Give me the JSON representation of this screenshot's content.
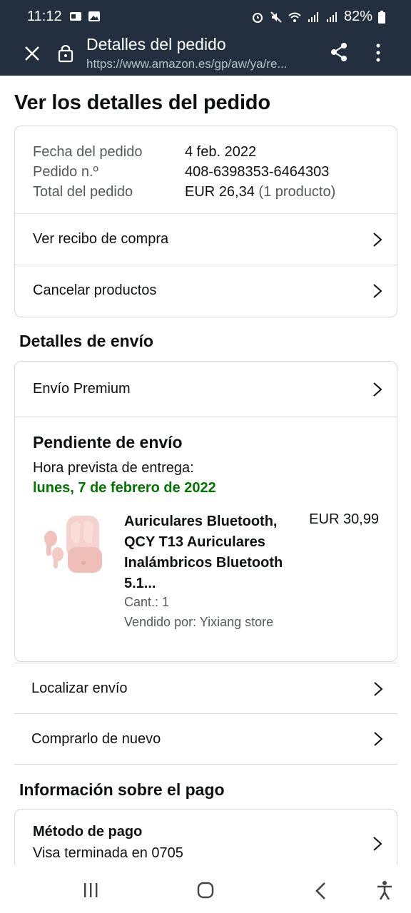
{
  "status_bar": {
    "time": "11:12",
    "battery": "82%"
  },
  "browser": {
    "title": "Detalles del pedido",
    "url": "https://www.amazon.es/gp/aw/ya/re..."
  },
  "page": {
    "heading": "Ver los detalles del pedido"
  },
  "order_summary": {
    "date_label": "Fecha del pedido",
    "date_value": "4 feb. 2022",
    "number_label": "Pedido n.º",
    "number_value": "408-6398353-6464303",
    "total_label": "Total del pedido",
    "total_value": "EUR 26,34",
    "total_items": "(1 producto)",
    "receipt_label": "Ver recibo de compra",
    "cancel_label": "Cancelar productos"
  },
  "shipping": {
    "heading": "Detalles de envío",
    "method": "Envío Premium",
    "status": "Pendiente de envío",
    "eta_label": "Hora prevista de entrega:",
    "eta_date": "lunes, 7 de febrero de 2022",
    "product": {
      "name": "Auriculares Bluetooth, QCY T13 Auriculares Inalámbricos Bluetooth 5.1...",
      "price": "EUR 30,99",
      "quantity": "Cant.: 1",
      "seller": "Vendido por: Yixiang store"
    },
    "track_label": "Localizar envío",
    "buy_again_label": "Comprarlo de nuevo"
  },
  "payment": {
    "heading": "Información sobre el pago",
    "method_label": "Método de pago",
    "method_value": "Visa terminada en 0705"
  },
  "colors": {
    "header_bg": "#232f3e",
    "delivery_green": "#007600",
    "product_pink": "#f4c7c3"
  }
}
